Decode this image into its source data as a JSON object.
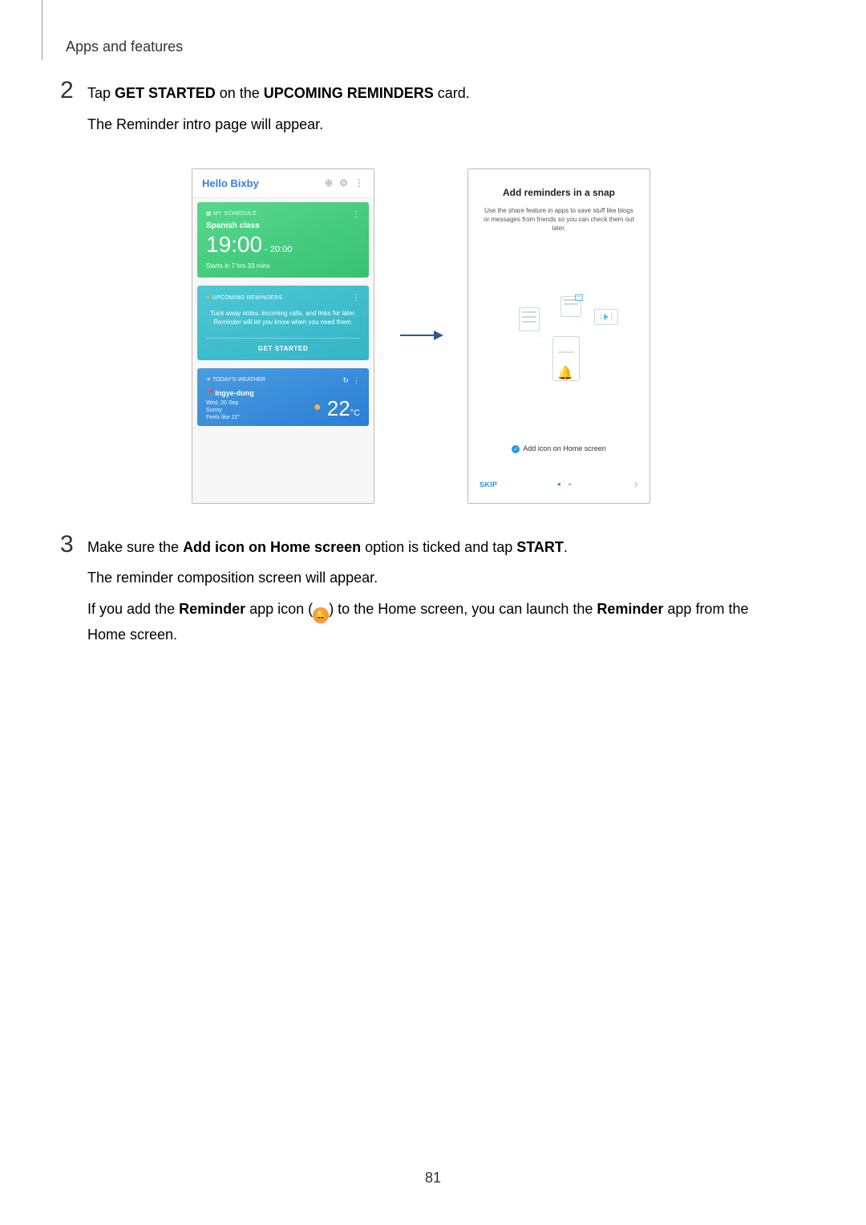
{
  "header": "Apps and features",
  "page_number": "81",
  "step2": {
    "num": "2",
    "line_a_pre": "Tap ",
    "line_a_b1": "GET STARTED",
    "line_a_mid": " on the ",
    "line_a_b2": "UPCOMING REMINDERS",
    "line_a_post": " card.",
    "line_b": "The Reminder intro page will appear."
  },
  "step3": {
    "num": "3",
    "line_a_pre": "Make sure the ",
    "line_a_b1": "Add icon on Home screen",
    "line_a_mid": " option is ticked and tap ",
    "line_a_b2": "START",
    "line_a_post": ".",
    "line_b": "The reminder composition screen will appear.",
    "line_c_pre": "If you add the ",
    "line_c_b1": "Reminder",
    "line_c_mid1": " app icon (",
    "line_c_mid2": ") to the Home screen, you can launch the ",
    "line_c_b2": "Reminder",
    "line_c_post": " app from the Home screen."
  },
  "bixby": {
    "title": "Hello Bixby",
    "schedule": {
      "label": "MY SCHEDULE",
      "title": "Spanish class",
      "time_main": "19:00",
      "time_end": " - 20:00",
      "sub": "Starts in 7 hrs 33 mins"
    },
    "reminders": {
      "label": "UPCOMING REMINDERS",
      "desc": "Tuck away notes, incoming calls, and links for later. Reminder will let you know when you need them.",
      "button": "GET STARTED"
    },
    "weather": {
      "label": "TODAY'S WEATHER",
      "location": "Ingye-dong",
      "date": "Wed, 20 Sep",
      "cond": "Sunny",
      "feels": "Feels like 22°",
      "temp": "22",
      "temp_unit": "°C"
    }
  },
  "intro": {
    "title": "Add reminders in a snap",
    "subtitle": "Use the share feature in apps to save stuff like blogs or messages from friends so you can check them out later.",
    "checkbox_label": "Add icon on Home screen",
    "skip": "SKIP"
  }
}
